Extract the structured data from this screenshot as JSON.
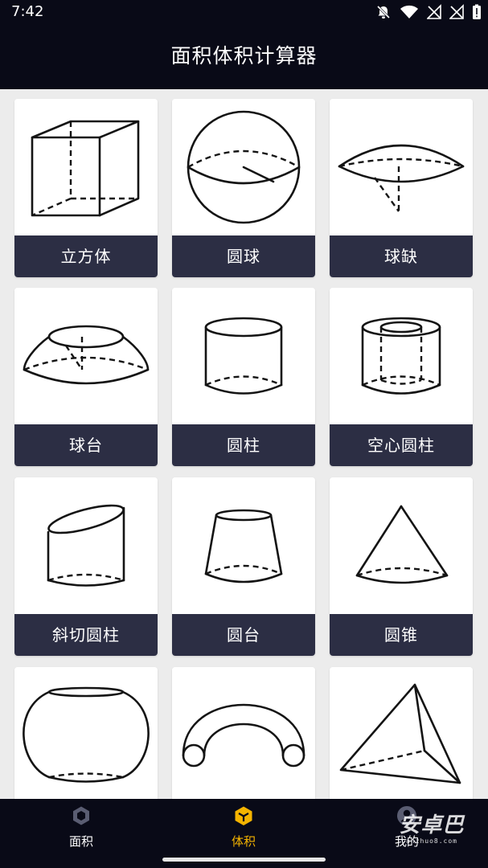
{
  "status_bar": {
    "time": "7:42"
  },
  "header": {
    "title": "面积体积计算器"
  },
  "shapes": [
    {
      "label": "立方体",
      "icon": "cube-icon"
    },
    {
      "label": "圆球",
      "icon": "sphere-icon"
    },
    {
      "label": "球缺",
      "icon": "spherical-cap-icon"
    },
    {
      "label": "球台",
      "icon": "spherical-segment-icon"
    },
    {
      "label": "圆柱",
      "icon": "cylinder-icon"
    },
    {
      "label": "空心圆柱",
      "icon": "hollow-cylinder-icon"
    },
    {
      "label": "斜切圆柱",
      "icon": "oblique-cut-cylinder-icon"
    },
    {
      "label": "圆台",
      "icon": "frustum-icon"
    },
    {
      "label": "圆锥",
      "icon": "cone-icon"
    },
    {
      "label": "",
      "icon": "barrel-icon"
    },
    {
      "label": "",
      "icon": "torus-icon"
    },
    {
      "label": "",
      "icon": "tetrahedron-icon"
    }
  ],
  "bottom_nav": {
    "items": [
      {
        "label": "面积",
        "icon": "hexagon-icon",
        "active": false
      },
      {
        "label": "体积",
        "icon": "cube-box-icon",
        "active": true
      },
      {
        "label": "我的",
        "icon": "user-icon",
        "active": false
      }
    ],
    "active_color": "#f5b400"
  },
  "watermark": {
    "main": "安卓巴",
    "sub": "anzhuo8.com"
  },
  "colors": {
    "header_bg": "#090a17",
    "label_bg": "#2c2e44",
    "page_bg": "#ececec"
  }
}
